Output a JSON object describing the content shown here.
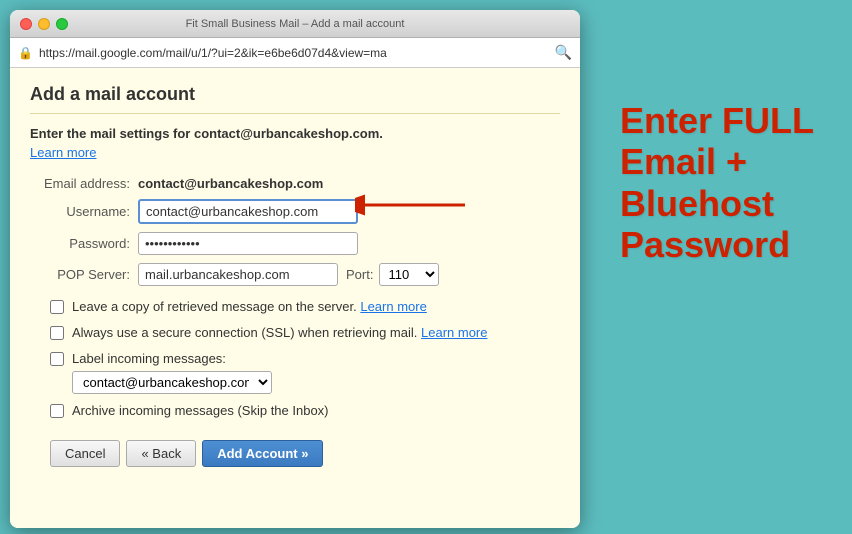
{
  "browser": {
    "title": "Fit Small Business Mail – Add a mail account",
    "url": "https://mail.google.com/mail/u/1/?ui=2&ik=e6be6d07d4&view=ma"
  },
  "modal": {
    "title": "Add a mail account",
    "intro": {
      "line1": "Enter the mail settings for contact@urbancakeshop.com.",
      "learn_more": "Learn more"
    },
    "form": {
      "email_label": "Email address:",
      "email_value": "contact@urbancakeshop.com",
      "username_label": "Username:",
      "username_value": "contact@urbancakeshop.com",
      "password_label": "Password:",
      "password_value": "••••••••••••",
      "pop_server_label": "POP Server:",
      "pop_server_value": "mail.urbancakeshop.com",
      "port_label": "Port:",
      "port_value": "110"
    },
    "options": {
      "leave_copy": "Leave a copy of retrieved message on the server.",
      "leave_copy_learn_more": "Learn more",
      "secure_ssl": "Always use a secure connection (SSL) when retrieving mail.",
      "secure_ssl_learn_more": "Learn more",
      "label_incoming": "Label incoming messages:",
      "label_value": "contact@urbancakeshop.com",
      "archive": "Archive incoming messages (Skip the Inbox)"
    },
    "buttons": {
      "cancel": "Cancel",
      "back": "« Back",
      "add_account": "Add Account »"
    }
  },
  "annotation": {
    "text": "Enter FULL Email + Bluehost Password"
  }
}
